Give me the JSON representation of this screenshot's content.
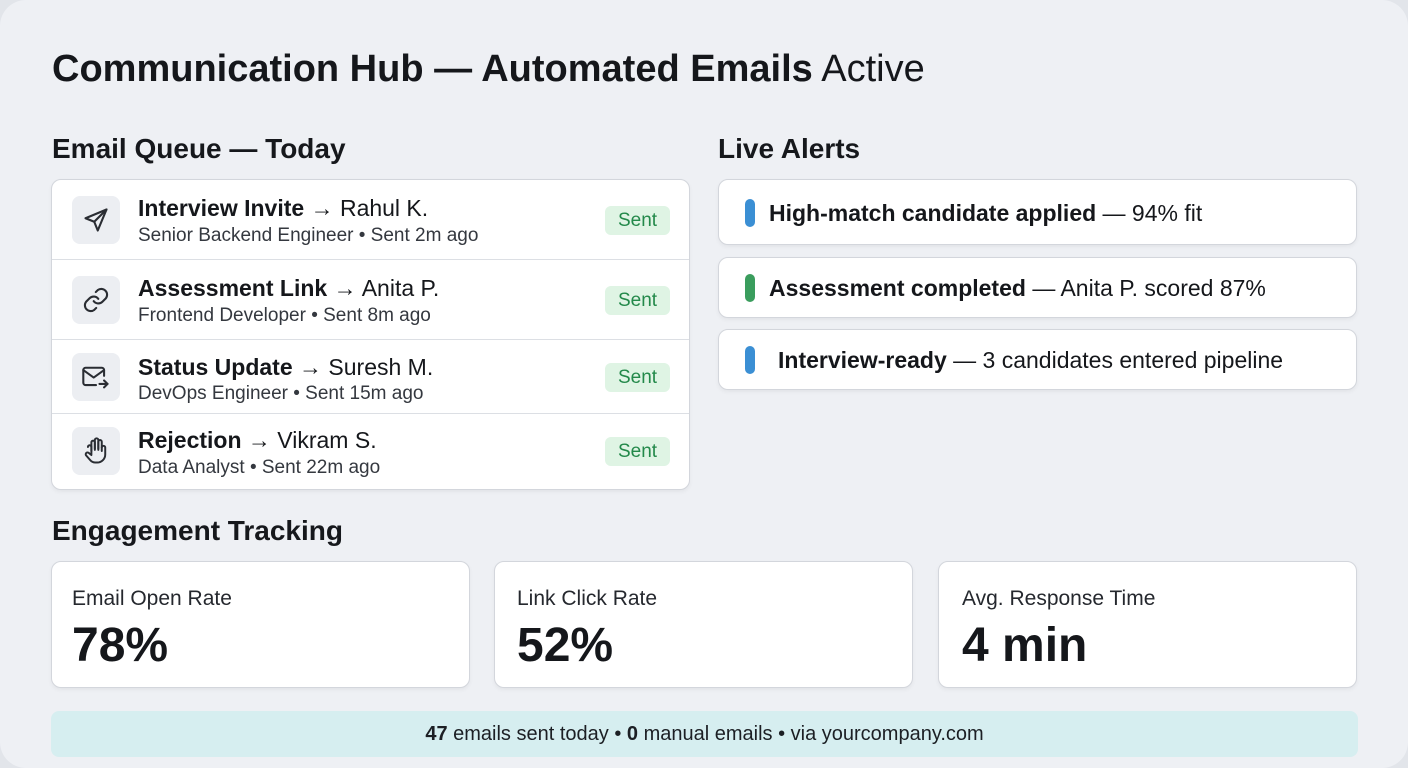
{
  "header": {
    "title_strong": "Communication Hub — Automated Emails",
    "title_light": "Active"
  },
  "queue": {
    "title": "Email Queue — Today",
    "items": [
      {
        "icon": "send-icon",
        "type": "Interview Invite",
        "recipient": "→ Rahul K.",
        "detail": "Senior Backend Engineer • Sent 2m ago",
        "status": "Sent"
      },
      {
        "icon": "link-icon",
        "type": "Assessment Link",
        "recipient": "→ Anita P.",
        "detail": "Frontend Developer • Sent 8m ago",
        "status": "Sent"
      },
      {
        "icon": "mail-forward-icon",
        "type": "Status Update",
        "recipient": "→ Suresh M.",
        "detail": "DevOps Engineer • Sent 15m ago",
        "status": "Sent"
      },
      {
        "icon": "hand-stop-icon",
        "type": "Rejection",
        "recipient": "→ Vikram S.",
        "detail": "Data Analyst • Sent 22m ago",
        "status": "Sent"
      }
    ]
  },
  "alerts": {
    "title": "Live Alerts",
    "items": [
      {
        "bold": "High-match candidate applied",
        "rest": " — 94% fit",
        "color": "#3b8fd4"
      },
      {
        "bold": "Assessment completed",
        "rest": " — Anita P. scored 87%",
        "color": "#3a9d5d"
      },
      {
        "bold": "Interview-ready",
        "rest": " — 3 candidates entered pipeline",
        "color": "#3b8fd4"
      }
    ]
  },
  "engagement": {
    "title": "Engagement Tracking",
    "metrics": [
      {
        "label": "Email Open Rate",
        "value": "78%"
      },
      {
        "label": "Link Click Rate",
        "value": "52%"
      },
      {
        "label": "Avg. Response Time",
        "value": "4 min"
      }
    ]
  },
  "footer": {
    "emails_sent_count": "47",
    "emails_sent_text": " emails sent today • ",
    "manual_count": "0",
    "manual_text": " manual emails • via yourcompany.com"
  }
}
